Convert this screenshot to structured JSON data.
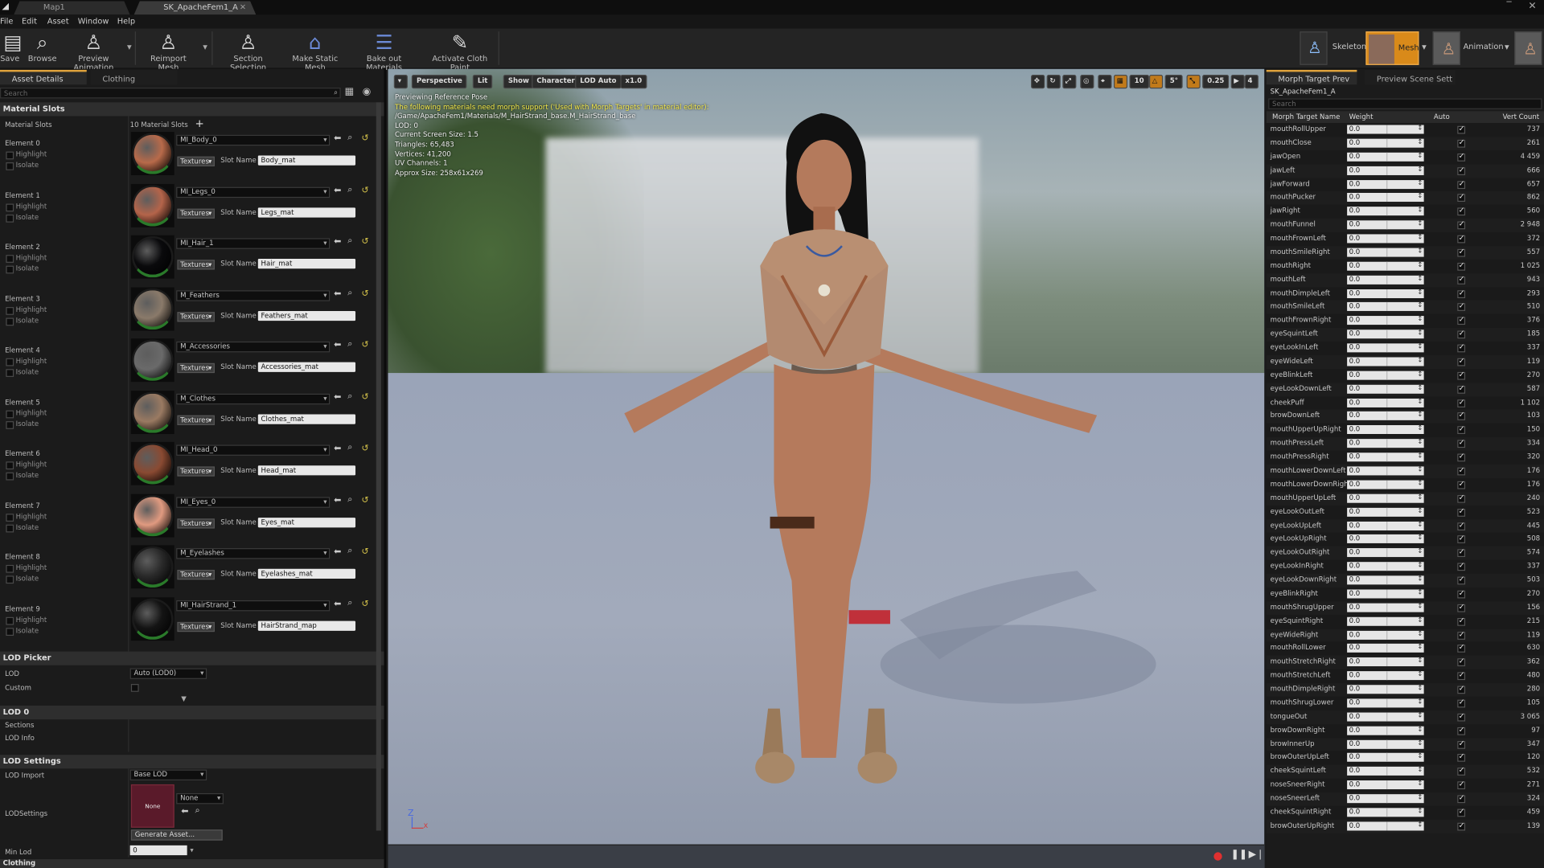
{
  "tabs": {
    "map": "Map1",
    "asset": "SK_ApacheFem1_A"
  },
  "menu": [
    "File",
    "Edit",
    "Asset",
    "Window",
    "Help"
  ],
  "toolbar": {
    "save": "Save",
    "browse": "Browse",
    "preview": "Preview Animation",
    "reimport": "Reimport Mesh",
    "section": "Section Selection",
    "static": "Make Static Mesh",
    "bake": "Bake out Materials",
    "cloth": "Activate Cloth Paint"
  },
  "modes": {
    "skeleton": "Skeleton",
    "mesh": "Mesh",
    "animation": "Animation"
  },
  "left": {
    "tab_details": "Asset Details",
    "tab_clothing": "Clothing",
    "search": "Search",
    "sec_material": "Material Slots",
    "slots_label": "Material Slots",
    "slots_count": "10 Material Slots",
    "highlight": "Highlight",
    "isolate": "Isolate",
    "textures": "Textures",
    "slot_name_label": "Slot Name",
    "elements": [
      {
        "label": "Element 0",
        "material": "MI_Body_0",
        "slot": "Body_mat",
        "color": "#b86a4a"
      },
      {
        "label": "Element 1",
        "material": "MI_Legs_0",
        "slot": "Legs_mat",
        "color": "#b4644a"
      },
      {
        "label": "Element 2",
        "material": "MI_Hair_1",
        "slot": "Hair_mat",
        "color": "#0a0a0c"
      },
      {
        "label": "Element 3",
        "material": "M_Feathers",
        "slot": "Feathers_mat",
        "color": "#8a7a6a"
      },
      {
        "label": "Element 4",
        "material": "M_Accessories",
        "slot": "Accessories_mat",
        "color": "#6a6a6a"
      },
      {
        "label": "Element 5",
        "material": "M_Clothes",
        "slot": "Clothes_mat",
        "color": "#9a7a62"
      },
      {
        "label": "Element 6",
        "material": "MI_Head_0",
        "slot": "Head_mat",
        "color": "#8a4a32"
      },
      {
        "label": "Element 7",
        "material": "MI_Eyes_0",
        "slot": "Eyes_mat",
        "color": "#e09a80"
      },
      {
        "label": "Element 8",
        "material": "M_Eyelashes",
        "slot": "Eyelashes_mat",
        "color": "#2a2a2a"
      },
      {
        "label": "Element 9",
        "material": "MI_HairStrand_1",
        "slot": "HairStrand_map",
        "color": "#141414"
      }
    ],
    "sec_lodpicker": "LOD Picker",
    "lod_label": "LOD",
    "lod_value": "Auto (LOD0)",
    "custom": "Custom",
    "sec_lod0": "LOD 0",
    "sections": "Sections",
    "lodinfo": "LOD Info",
    "sec_lodsettings": "LOD Settings",
    "lodimport": "LOD Import",
    "lodimport_value": "Base LOD",
    "lodsettings": "LODSettings",
    "none_thumb": "None",
    "none_drop": "None",
    "generate": "Generate Asset...",
    "minlod": "Min Lod",
    "minlod_value": "0",
    "sec_clothing": "Clothing"
  },
  "viewport": {
    "perspective": "Perspective",
    "lit": "Lit",
    "show": "Show",
    "character": "Character",
    "lodauto": "LOD Auto",
    "speed": "x1.0",
    "grid": "10",
    "angle": "5°",
    "scale": "0.25",
    "cam": "4",
    "info": [
      {
        "t": "Previewing Reference Pose",
        "c": "white"
      },
      {
        "t": "The following materials need morph support ('Used with Morph Targets' in material editor):",
        "c": "yellow"
      },
      {
        "t": "/Game/ApacheFem1/Materials/M_HairStrand_base.M_HairStrand_base",
        "c": "white"
      },
      {
        "t": "LOD: 0",
        "c": "white"
      },
      {
        "t": "Current Screen Size: 1.5",
        "c": "white"
      },
      {
        "t": "Triangles: 65,483",
        "c": "white"
      },
      {
        "t": "Vertices: 41,200",
        "c": "white"
      },
      {
        "t": "UV Channels: 1",
        "c": "white"
      },
      {
        "t": "Approx Size: 258x61x269",
        "c": "white"
      }
    ]
  },
  "right": {
    "tab_morph": "Morph Target Prev",
    "tab_scene": "Preview Scene Sett",
    "asset": "SK_ApacheFem1_A",
    "search": "Search",
    "h_name": "Morph Target Name",
    "h_weight": "Weight",
    "h_auto": "Auto",
    "h_vert": "Vert Count",
    "weight": "0.0",
    "rows": [
      [
        "mouthRollUpper",
        "737"
      ],
      [
        "mouthClose",
        "261"
      ],
      [
        "jawOpen",
        "4 459"
      ],
      [
        "jawLeft",
        "666"
      ],
      [
        "jawForward",
        "657"
      ],
      [
        "mouthPucker",
        "862"
      ],
      [
        "jawRight",
        "560"
      ],
      [
        "mouthFunnel",
        "2 948"
      ],
      [
        "mouthFrownLeft",
        "372"
      ],
      [
        "mouthSmileRight",
        "557"
      ],
      [
        "mouthRight",
        "1 025"
      ],
      [
        "mouthLeft",
        "943"
      ],
      [
        "mouthDimpleLeft",
        "293"
      ],
      [
        "mouthSmileLeft",
        "510"
      ],
      [
        "mouthFrownRight",
        "376"
      ],
      [
        "eyeSquintLeft",
        "185"
      ],
      [
        "eyeLookInLeft",
        "337"
      ],
      [
        "eyeWideLeft",
        "119"
      ],
      [
        "eyeBlinkLeft",
        "270"
      ],
      [
        "eyeLookDownLeft",
        "587"
      ],
      [
        "cheekPuff",
        "1 102"
      ],
      [
        "browDownLeft",
        "103"
      ],
      [
        "mouthUpperUpRight",
        "150"
      ],
      [
        "mouthPressLeft",
        "334"
      ],
      [
        "mouthPressRight",
        "320"
      ],
      [
        "mouthLowerDownLeft",
        "176"
      ],
      [
        "mouthLowerDownRight",
        "176"
      ],
      [
        "mouthUpperUpLeft",
        "240"
      ],
      [
        "eyeLookOutLeft",
        "523"
      ],
      [
        "eyeLookUpLeft",
        "445"
      ],
      [
        "eyeLookUpRight",
        "508"
      ],
      [
        "eyeLookOutRight",
        "574"
      ],
      [
        "eyeLookInRight",
        "337"
      ],
      [
        "eyeLookDownRight",
        "503"
      ],
      [
        "eyeBlinkRight",
        "270"
      ],
      [
        "mouthShrugUpper",
        "156"
      ],
      [
        "eyeSquintRight",
        "215"
      ],
      [
        "eyeWideRight",
        "119"
      ],
      [
        "mouthRollLower",
        "630"
      ],
      [
        "mouthStretchRight",
        "362"
      ],
      [
        "mouthStretchLeft",
        "480"
      ],
      [
        "mouthDimpleRight",
        "280"
      ],
      [
        "mouthShrugLower",
        "105"
      ],
      [
        "tongueOut",
        "3 065"
      ],
      [
        "browDownRight",
        "97"
      ],
      [
        "browInnerUp",
        "347"
      ],
      [
        "browOuterUpLeft",
        "120"
      ],
      [
        "cheekSquintLeft",
        "532"
      ],
      [
        "noseSneerRight",
        "271"
      ],
      [
        "noseSneerLeft",
        "324"
      ],
      [
        "cheekSquintRight",
        "459"
      ],
      [
        "browOuterUpRight",
        "139"
      ]
    ]
  }
}
